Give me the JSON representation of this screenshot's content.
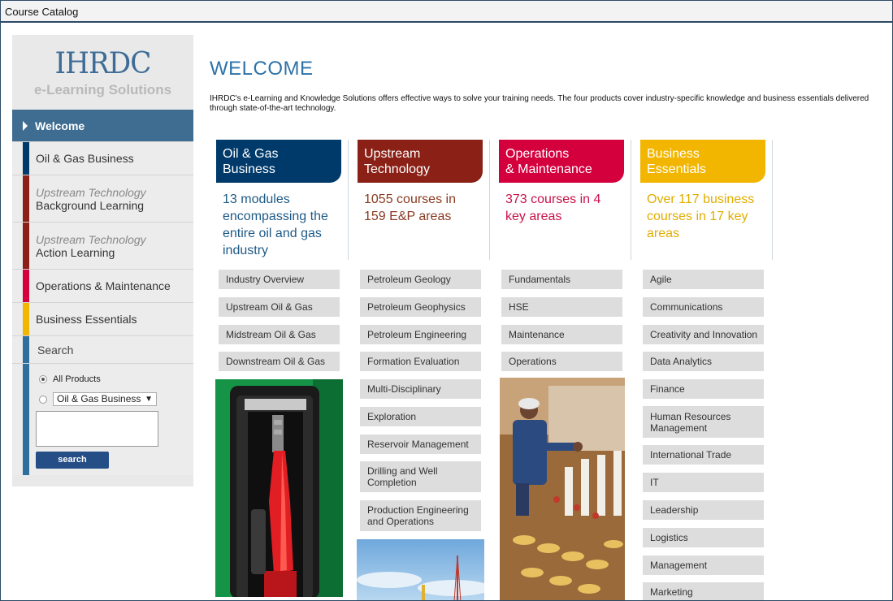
{
  "window": {
    "title": "Course Catalog"
  },
  "logo": {
    "brand": "IHRDC",
    "tagline": "e-Learning Solutions"
  },
  "nav": {
    "welcome": "Welcome",
    "oil_gas": "Oil & Gas Business",
    "upstream_bg_it": "Upstream Technology",
    "upstream_bg": "Background Learning",
    "upstream_al_it": "Upstream Technology",
    "upstream_al": "Action Learning",
    "ops": "Operations & Maintenance",
    "business": "Business Essentials"
  },
  "search": {
    "header": "Search",
    "all_products": "All Products",
    "product_select": "Oil & Gas Business",
    "button": "search"
  },
  "main": {
    "title": "WELCOME",
    "intro": "IHRDC's e-Learning and Knowledge Solutions offers effective ways to solve your training needs. The four products cover industry-specific knowledge and business essentials delivered through state-of-the-art technology."
  },
  "colors": {
    "oil_gas": "#003a6b",
    "upstream": "#8a2016",
    "ops": "#d4003e",
    "business": "#f2b600"
  },
  "products": {
    "oil_gas": {
      "title1": "Oil & Gas",
      "title2": "Business",
      "desc": "13 modules encompassing the entire oil and gas industry",
      "items": [
        "Industry Overview",
        "Upstream Oil & Gas",
        "Midstream Oil & Gas",
        "Downstream Oil & Gas"
      ]
    },
    "upstream": {
      "title1": "Upstream",
      "title2": "Technology",
      "desc": "1055 courses in 159 E&P areas",
      "items": [
        "Petroleum Geology",
        "Petroleum Geophysics",
        "Petroleum Engineering",
        "Formation Evaluation",
        "Multi-Disciplinary",
        "Exploration",
        "Reservoir Management",
        "Drilling and Well Completion",
        "Production Engineering and Operations"
      ]
    },
    "ops": {
      "title1": "Operations",
      "title2": "& Maintenance",
      "desc": "373 courses in 4 key areas",
      "items": [
        "Fundamentals",
        "HSE",
        "Maintenance",
        "Operations"
      ]
    },
    "business": {
      "title1": "Business",
      "title2": "Essentials",
      "desc": "Over 117 business courses in 17 key areas",
      "items": [
        "Agile",
        "Communications",
        "Creativity and Innovation",
        "Data Analytics",
        "Finance",
        "Human Resources Management",
        "International Trade",
        "IT",
        "Leadership",
        "Logistics",
        "Management",
        "Marketing"
      ]
    }
  }
}
